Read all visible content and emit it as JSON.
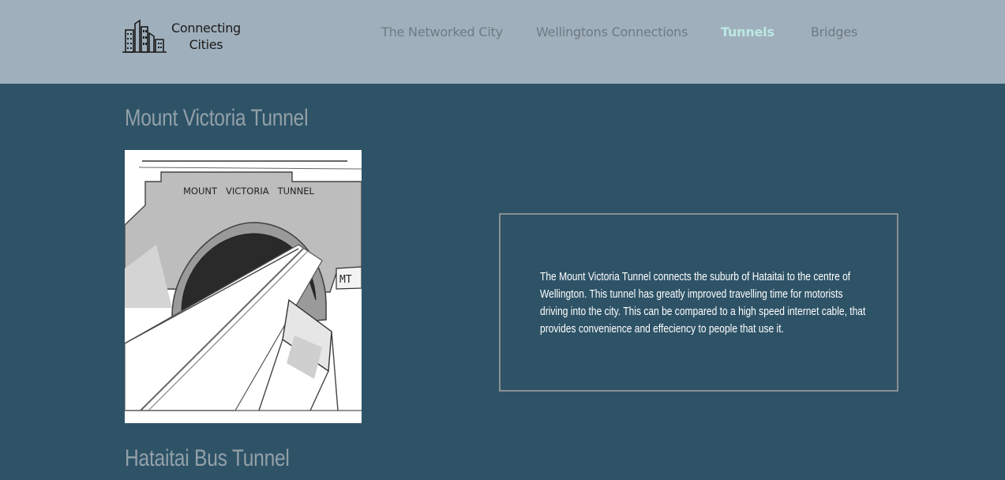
{
  "header": {
    "logo_text_line1": "Connecting",
    "logo_text_line2": "Cities",
    "logo_icon": "city-skyline-icon",
    "nav": [
      {
        "label": "The Networked City",
        "active": false
      },
      {
        "label": "Wellingtons Connections",
        "active": false
      },
      {
        "label": "Tunnels",
        "active": true
      },
      {
        "label": "Bridges",
        "active": false
      }
    ]
  },
  "sections": [
    {
      "title": "Mount Victoria Tunnel",
      "image_sign_text": "MOUNT   VICTORIA   TUNNEL",
      "image_side_sign": "MT",
      "description": "The Mount Victoria Tunnel connects the suburb of Hataitai to the centre of Wellington. This tunnel has greatly improved travelling time for motorists driving into the city. This can be compared to a high speed internet cable, that provides convenience and effeciency to people that use it."
    },
    {
      "title": "Hataitai Bus Tunnel"
    }
  ],
  "colors": {
    "header_bg": "#9fb0bc",
    "body_bg": "#2e5367",
    "nav_active": "#bde7e4",
    "nav_inactive": "#707a82",
    "title": "#93a0a8"
  }
}
